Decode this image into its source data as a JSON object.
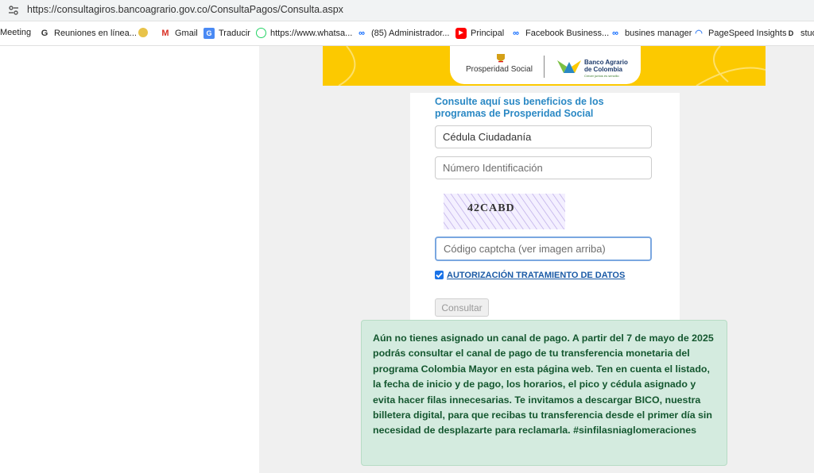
{
  "browser": {
    "url": "https://consultagiros.bancoagrario.gov.co/ConsultaPagos/Consulta.aspx",
    "bookmarks": [
      {
        "label": "Meeting",
        "icon": "none"
      },
      {
        "label": "Reuniones en línea...",
        "icon": "g-icon"
      },
      {
        "label": "",
        "icon": "colombia-seal-icon"
      },
      {
        "label": "Gmail",
        "icon": "gmail-icon"
      },
      {
        "label": "Traducir",
        "icon": "translate-icon"
      },
      {
        "label": "https://www.whatsa...",
        "icon": "whatsapp-icon"
      },
      {
        "label": "(85) Administrador...",
        "icon": "meta-icon"
      },
      {
        "label": "Principal",
        "icon": "youtube-icon"
      },
      {
        "label": "Facebook Business...",
        "icon": "meta-icon"
      },
      {
        "label": "busines manager",
        "icon": "meta-icon"
      },
      {
        "label": "PageSpeed Insights",
        "icon": "pagespeed-icon"
      },
      {
        "label": "stud",
        "icon": "d-icon"
      }
    ]
  },
  "banner": {
    "left_logo_text": "Prosperidad Social",
    "right_logo_text_line1": "Banco Agrario",
    "right_logo_text_line2": "de Colombia",
    "right_logo_tagline": "Crecer juntos es sencillo"
  },
  "form": {
    "title": "Consulte aquí sus beneficios de los programas de Prosperidad Social",
    "document_type": "Cédula Ciudadanía",
    "id_placeholder": "Número Identificación",
    "captcha_text": "42CABD",
    "captcha_placeholder": "Código captcha (ver imagen arriba)",
    "authorization_label": "AUTORIZACIÓN TRATAMIENTO DE DATOS",
    "authorization_checked": true,
    "submit_label": "Consultar"
  },
  "alert": {
    "message": "Aún no tienes asignado un canal de pago. A partir del 7 de mayo de 2025 podrás consultar el canal de pago de tu transferencia monetaria del programa Colombia Mayor en esta página web. Ten en cuenta el listado, la fecha de inicio y de pago, los horarios, el pico y cédula asignado y evita hacer filas innecesarias. Te invitamos a descargar BICO, nuestra billetera digital, para que recibas tu transferencia desde el primer día sin necesidad de desplazarte para reclamarla. #sinfilasniaglomeraciones"
  },
  "colors": {
    "banner_yellow": "#fcc900",
    "title_blue": "#2a88c4",
    "alert_bg": "#d4ebdf",
    "alert_text": "#14572f"
  }
}
